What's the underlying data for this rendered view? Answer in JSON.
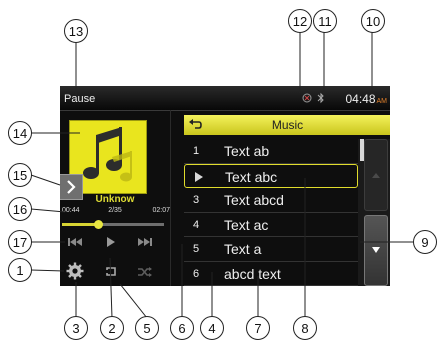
{
  "status_bar": {
    "status_text": "Pause",
    "clock_time": "04:48",
    "clock_ampm": "AM",
    "network_icon": "signal-icon",
    "bluetooth_icon": "bluetooth-icon"
  },
  "now_playing": {
    "album_art_icon": "music-note-icon",
    "track_name": "Unknow",
    "time_elapsed": "00:44",
    "track_count": "2/35",
    "time_total": "02:07",
    "progress": 0.35
  },
  "controls": {
    "previous_icon": "previous-track-icon",
    "play_icon": "play-icon",
    "next_icon": "next-track-icon",
    "settings_icon": "gear-icon",
    "repeat_icon": "repeat-icon",
    "shuffle_icon": "shuffle-icon",
    "list_toggle_icon": "chevron-right-icon"
  },
  "playlist": {
    "title": "Music",
    "back_icon": "back-arrow-icon",
    "rows": [
      {
        "num": "1",
        "text": "Text ab",
        "selected": false
      },
      {
        "num": "",
        "text": "Text abc",
        "selected": true
      },
      {
        "num": "3",
        "text": "Text abcd",
        "selected": false
      },
      {
        "num": "4",
        "text": "Text ac",
        "selected": false
      },
      {
        "num": "5",
        "text": "Text a",
        "selected": false
      },
      {
        "num": "6",
        "text": "abcd text",
        "selected": false
      }
    ],
    "scroll_up_icon": "scroll-up-icon",
    "scroll_down_icon": "scroll-down-icon"
  },
  "callouts": [
    "1",
    "2",
    "3",
    "4",
    "5",
    "6",
    "7",
    "8",
    "9",
    "10",
    "11",
    "12",
    "13",
    "14",
    "15",
    "16",
    "17"
  ],
  "colors": {
    "accent": "#e0dc2c",
    "screen_bg": "#0e0e0e",
    "ampm": "#e07f2a"
  }
}
